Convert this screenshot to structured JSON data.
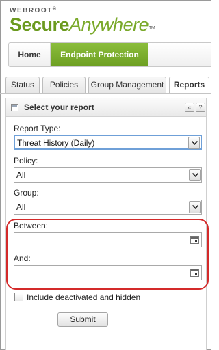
{
  "brand": {
    "top": "WEBROOT",
    "reg": "®",
    "main_bold": "Secure",
    "main_italic": "Anywhere",
    "tm": "TM"
  },
  "mainnav": {
    "home": "Home",
    "endpoint": "Endpoint Protection"
  },
  "tabs": [
    {
      "label": "Status"
    },
    {
      "label": "Policies"
    },
    {
      "label": "Group Management"
    },
    {
      "label": "Reports",
      "active": true
    }
  ],
  "panel": {
    "title": "Select your report",
    "collapse_icon": "«",
    "help_icon": "?"
  },
  "form": {
    "report_type_label": "Report Type:",
    "report_type_value": "Threat History (Daily)",
    "policy_label": "Policy:",
    "policy_value": "All",
    "group_label": "Group:",
    "group_value": "All",
    "between_label": "Between:",
    "between_value": "",
    "and_label": "And:",
    "and_value": "",
    "include_label": "Include deactivated and hidden",
    "include_checked": false,
    "submit_label": "Submit"
  },
  "colors": {
    "brand_green": "#6b9a1f",
    "active_nav": "#7aae2f",
    "highlight_red": "#d42a2a",
    "focus_blue": "#6fa0d8"
  }
}
